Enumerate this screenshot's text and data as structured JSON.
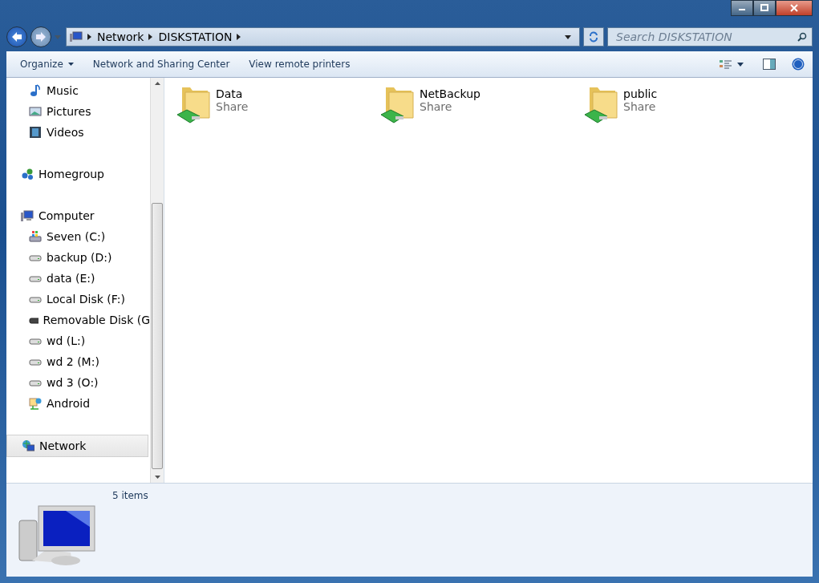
{
  "address": {
    "crumbs": [
      "Network",
      "DISKSTATION"
    ]
  },
  "search": {
    "placeholder": "Search DISKSTATION"
  },
  "toolbar": {
    "buttons": [
      {
        "label": "Organize",
        "dropdown": true
      },
      {
        "label": "Network and Sharing Center",
        "dropdown": false
      },
      {
        "label": "View remote printers",
        "dropdown": false
      }
    ]
  },
  "sidebar": {
    "sections": [
      {
        "children": [
          {
            "label": "Music",
            "kind": "music",
            "selected": false
          },
          {
            "label": "Pictures",
            "kind": "pictures",
            "selected": false
          },
          {
            "label": "Videos",
            "kind": "videos",
            "selected": false
          }
        ]
      },
      {
        "label": "Homegroup",
        "kind": "homegroup",
        "selected": false
      },
      {
        "label": "Computer",
        "kind": "computer",
        "selected": false,
        "children": [
          {
            "label": "Seven (C:)",
            "kind": "system-drive",
            "selected": false
          },
          {
            "label": "backup (D:)",
            "kind": "drive",
            "selected": false
          },
          {
            "label": "data (E:)",
            "kind": "drive",
            "selected": false
          },
          {
            "label": "Local Disk (F:)",
            "kind": "drive",
            "selected": false
          },
          {
            "label": "Removable Disk (G",
            "kind": "removable",
            "selected": false
          },
          {
            "label": "wd (L:)",
            "kind": "drive",
            "selected": false
          },
          {
            "label": "wd 2 (M:)",
            "kind": "drive",
            "selected": false
          },
          {
            "label": "wd 3 (O:)",
            "kind": "drive",
            "selected": false
          },
          {
            "label": "Android",
            "kind": "device",
            "selected": false
          }
        ]
      },
      {
        "label": "Network",
        "kind": "network",
        "selected": true
      }
    ]
  },
  "items": [
    {
      "name": "Data",
      "type": "Share"
    },
    {
      "name": "NetBackup",
      "type": "Share"
    },
    {
      "name": "public",
      "type": "Share"
    }
  ],
  "status_bar": {
    "count": "5 items"
  }
}
